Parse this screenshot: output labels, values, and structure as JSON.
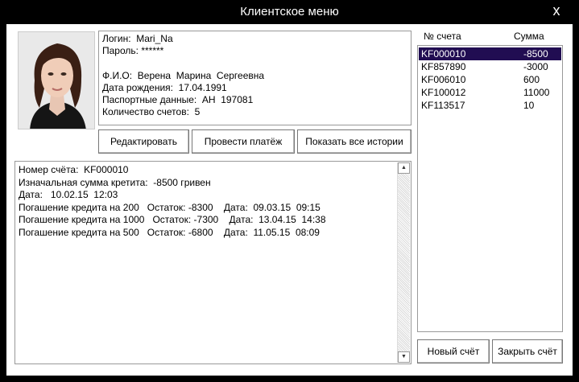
{
  "window": {
    "title": "Клиентское меню",
    "close_label": "x"
  },
  "profile": {
    "login_label": "Логин:",
    "login": "Mari_Na",
    "password_label": "Пароль:",
    "password": "******",
    "fio_label": "Ф.И.О:",
    "fio": "Верена  Марина  Сергеевна",
    "dob_label": "Дата рождения:",
    "dob": "17.04.1991",
    "passport_label": "Паспортные данные:",
    "passport": "АН  197081",
    "accounts_count_label": "Количество счетов:",
    "accounts_count": "5"
  },
  "buttons": {
    "edit": "Редактировать",
    "pay": "Провести платёж",
    "history": "Показать все истории",
    "new_account": "Новый счёт",
    "close_account": "Закрыть счёт"
  },
  "history": {
    "lines": [
      "Номер счёта:  KF000010",
      "Изначальная сумма кретита:  -8500 гривен",
      "Дата:   10.02.15  12:03",
      "Погашение кредита на 200   Остаток: -8300    Дата:  09.03.15  09:15",
      "Погашение кредита на 1000   Остаток: -7300    Дата:  13.04.15  14:38",
      "Погашение кредита на 500   Остаток: -6800    Дата:  11.05.15  08:09"
    ]
  },
  "accounts": {
    "col_number": "№ счета",
    "col_sum": "Сумма",
    "rows": [
      {
        "number": "KF000010",
        "sum": "-8500",
        "selected": true
      },
      {
        "number": "KF857890",
        "sum": "-3000",
        "selected": false
      },
      {
        "number": "KF006010",
        "sum": "600",
        "selected": false
      },
      {
        "number": "KF100012",
        "sum": "11000",
        "selected": false
      },
      {
        "number": "KF113517",
        "sum": "10",
        "selected": false
      }
    ]
  },
  "colors": {
    "selection": "#210d52",
    "frame": "#000000"
  }
}
